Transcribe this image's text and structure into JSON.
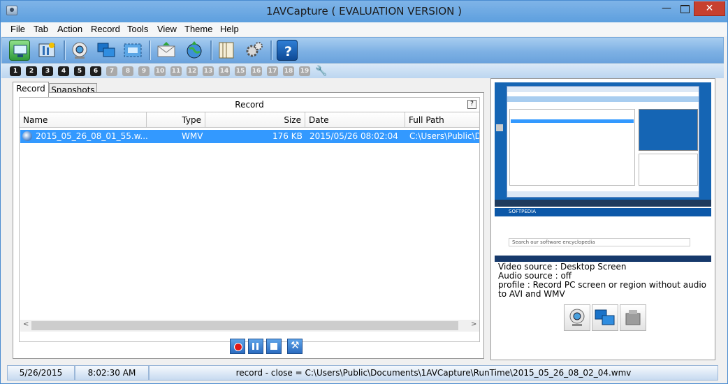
{
  "window": {
    "title": "1AVCapture ( EVALUATION VERSION )",
    "min_glyph": "—",
    "close_glyph": "✕"
  },
  "menu": [
    "File",
    "Tab",
    "Action",
    "Record",
    "Tools",
    "View",
    "Theme",
    "Help"
  ],
  "toolbar": {
    "buttons": [
      "monitor-icon",
      "settings-icon",
      "webcam-icon",
      "screen-icon",
      "region-icon",
      "email-icon",
      "globe-icon",
      "book-icon",
      "gear-icon",
      "help-icon"
    ]
  },
  "tab_numbers": [
    "1",
    "2",
    "3",
    "4",
    "5",
    "6",
    "7",
    "8",
    "9",
    "10",
    "11",
    "12",
    "13",
    "14",
    "15",
    "16",
    "17",
    "18",
    "19"
  ],
  "tabs": {
    "record": "Record",
    "snapshots": "Snapshots"
  },
  "record_panel": {
    "title": "Record",
    "help": "?",
    "columns": [
      "Name",
      "Type",
      "Size",
      "Date",
      "Full Path"
    ],
    "rows": [
      {
        "name": "2015_05_26_08_01_55.w...",
        "type": "WMV",
        "size": "176 KB",
        "date": "2015/05/26 08:02:04",
        "path": "C:\\Users\\Public\\D"
      }
    ],
    "scroll_left": "<",
    "scroll_right": ">"
  },
  "preview": {
    "browser_brand": "SOFTPEDIA",
    "browser_search": "Search our software encyclopedia"
  },
  "info": {
    "video_source": "Video source : Desktop Screen",
    "audio_source": "Audio source : off",
    "profile": "profile : Record PC screen or region without audio to AVI and WMV"
  },
  "status": {
    "date": "5/26/2015",
    "time": "8:02:30 AM",
    "message": "record - close = C:\\Users\\Public\\Documents\\1AVCapture\\RunTime\\2015_05_26_08_02_04.wmv"
  },
  "colors": {
    "accent": "#3399ff",
    "toolbar": "#7eb1e4",
    "close": "#c7402f"
  }
}
